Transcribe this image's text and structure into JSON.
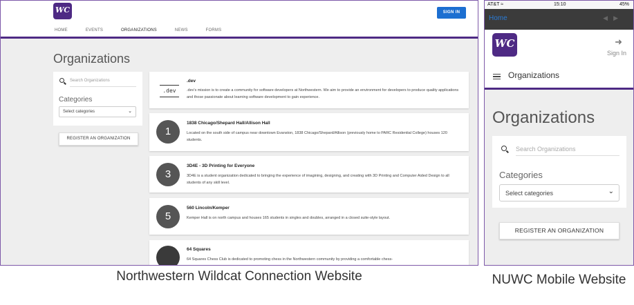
{
  "desktop": {
    "logo_text": "WC",
    "signin_label": "SIGN IN",
    "nav": [
      "HOME",
      "EVENTS",
      "ORGANIZATIONS",
      "NEWS",
      "FORMS"
    ],
    "page_title": "Organizations",
    "search_placeholder": "Search Organizations",
    "categories_label": "Categories",
    "select_value": "Select categories",
    "register_label": "REGISTER AN ORGANIZATION",
    "organizations": [
      {
        "avatar": ".dev",
        "name": ".dev",
        "desc": ".dev's mission is to create a community for software developers at Northwestern. We aim to provide an environment for developers to produce quality applications and those passionate about learning software development to gain experience."
      },
      {
        "avatar": "1",
        "name": "1838 Chicago/Shepard Hall/Allison Hall",
        "desc": "Located on the south side of campus near downtown Evanston, 1838 Chicago/Shepard/Allison (previously home to PARC Residential College) houses 120 students."
      },
      {
        "avatar": "3",
        "name": "3D4E - 3D Printing for Everyone",
        "desc": "3D4E is a student organization dedicated to bringing the experience of imagining, designing, and creating with 3D Printing and Computer Aided Design to all students of any skill level."
      },
      {
        "avatar": "5",
        "name": "560 Lincoln/Kemper",
        "desc": "Kemper Hall is on north campus and houses 165 students in singles and doubles, arranged in a closed suite-style layout."
      },
      {
        "avatar": "",
        "name": "64 Squares",
        "desc": "64 Squares Chess Club is dedicated to promoting chess in the Northwestern community by providing a comfortable chess-"
      }
    ],
    "caption": "Northwestern Wildcat Connection Website"
  },
  "mobile": {
    "status_carrier": "AT&T",
    "status_time": "15:10",
    "status_battery": "45%",
    "home_link": "Home",
    "logo_text": "WC",
    "signin_label": "Sign In",
    "section_title": "Organizations",
    "page_title": "Organizations",
    "search_placeholder": "Search Organizations",
    "categories_label": "Categories",
    "select_value": "Select categories",
    "register_label": "REGISTER AN ORGANIZATION",
    "caption": "NUWC Mobile Website"
  },
  "colors": {
    "brand_purple": "#4e2a84",
    "signin_blue": "#1c6fd1",
    "home_link_blue": "#2a7bd6"
  },
  "icons": [
    "search-icon",
    "chevron-down-icon",
    "hamburger-icon",
    "sign-in-icon",
    "wifi-icon"
  ]
}
